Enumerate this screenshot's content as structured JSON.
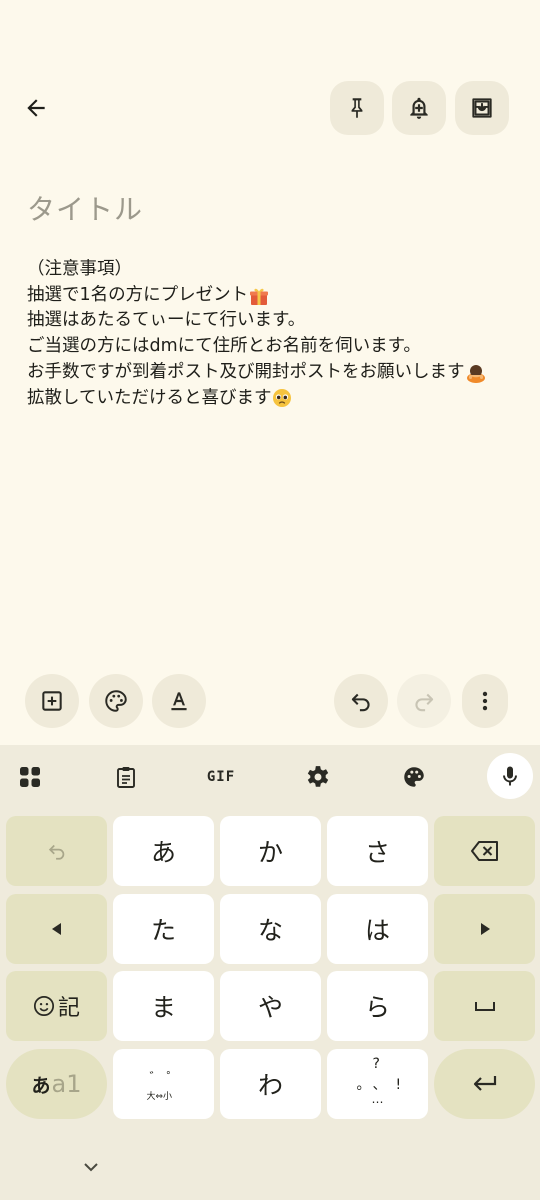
{
  "note": {
    "title_placeholder": "タイトル",
    "lines": [
      {
        "text": "（注意事項）",
        "emoji": ""
      },
      {
        "text": "抽選で1名の方にプレゼント",
        "emoji": "gift"
      },
      {
        "text": "抽選はあたるてぃーにて行います。",
        "emoji": ""
      },
      {
        "text": "ご当選の方にはdmにて住所とお名前を伺います。",
        "emoji": ""
      },
      {
        "text": "お手数ですが到着ポスト及び開封ポストをお願いします",
        "emoji": "bowing-person"
      },
      {
        "text": "拡散していただけると喜びます",
        "emoji": "pleading-face"
      }
    ]
  },
  "keyboard": {
    "toolbar": {
      "gif": "GIF"
    },
    "keys": {
      "a": "あ",
      "ka": "か",
      "sa": "さ",
      "ta": "た",
      "na": "な",
      "ha": "は",
      "ma": "ま",
      "ya": "や",
      "ra": "ら",
      "wa": "わ",
      "symbol_label": "記",
      "mode_kana": "あ",
      "mode_alnum": "a1",
      "dakuten_top": "゛゜",
      "dakuten_bottom": "大⇔小",
      "punct_top": "?",
      "punct_middle": "。、!",
      "punct_bottom": "…"
    }
  },
  "colors": {
    "background": "#fdf9ec",
    "button_bg": "#efead9",
    "keyboard_bg": "#efebdc",
    "fn_key": "#e4e2c1",
    "key": "#ffffff"
  }
}
